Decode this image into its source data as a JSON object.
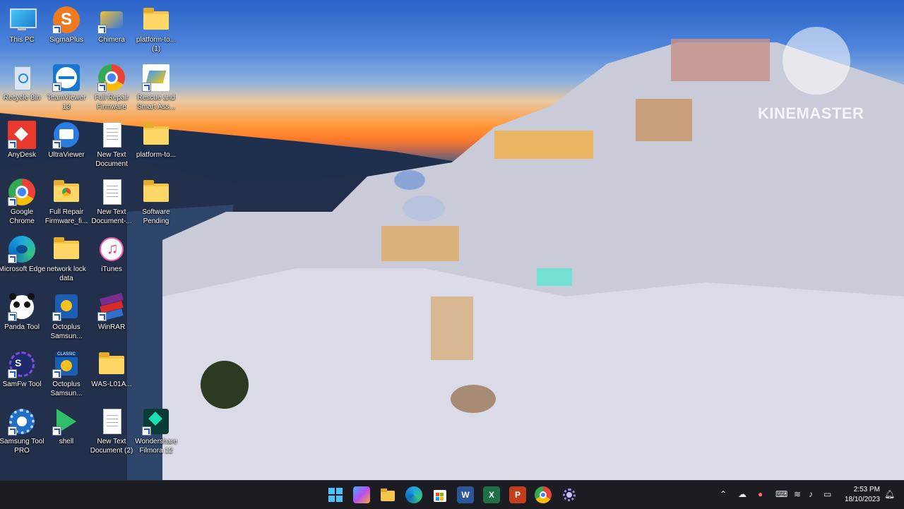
{
  "desktop": {
    "icons": [
      {
        "label": "This PC",
        "icon": "monitor-icon"
      },
      {
        "label": "SigmaPlus",
        "icon": "sigmaplus-icon"
      },
      {
        "label": "Chimera",
        "icon": "chimera-icon"
      },
      {
        "label": "platform-to... (1)",
        "icon": "folder-icon"
      },
      {
        "label": "Recycle Bin",
        "icon": "recycle-bin-icon"
      },
      {
        "label": "TeamViewer 13",
        "icon": "teamviewer-icon"
      },
      {
        "label": "Full Repair Firmware",
        "icon": "chrome-icon"
      },
      {
        "label": "Rescue and Smart Ass...",
        "icon": "rescue-smart-assistant-icon"
      },
      {
        "label": "AnyDesk",
        "icon": "anydesk-icon"
      },
      {
        "label": "UltraViewer",
        "icon": "ultraviewer-icon"
      },
      {
        "label": "New Text Document",
        "icon": "text-document-icon"
      },
      {
        "label": "platform-to...",
        "icon": "folder-icon"
      },
      {
        "label": "Google Chrome",
        "icon": "chrome-icon"
      },
      {
        "label": "Full Repair Firmware_fi...",
        "icon": "folder-icon"
      },
      {
        "label": "New Text Document-...",
        "icon": "text-document-icon"
      },
      {
        "label": "Software Pending",
        "icon": "folder-icon"
      },
      {
        "label": "Microsoft Edge",
        "icon": "edge-icon"
      },
      {
        "label": "network lock data",
        "icon": "folder-icon"
      },
      {
        "label": "iTunes",
        "icon": "itunes-icon"
      },
      {
        "label": "Panda Tool",
        "icon": "panda-icon"
      },
      {
        "label": "Octoplus Samsun...",
        "icon": "octoplus-icon"
      },
      {
        "label": "WinRAR",
        "icon": "winrar-icon"
      },
      {
        "label": "SamFw Tool",
        "icon": "samfw-icon"
      },
      {
        "label": "Octoplus Samsun...",
        "icon": "octoplus-classic-icon"
      },
      {
        "label": "WAS-L01A...",
        "icon": "folder-icon"
      },
      {
        "label": "Samsung Tool PRO",
        "icon": "samsung-tool-icon"
      },
      {
        "label": "shell",
        "icon": "shell-icon"
      },
      {
        "label": "New Text Document (2)",
        "icon": "text-document-icon"
      },
      {
        "label": "Wondershare Filmora 12",
        "icon": "filmora-icon"
      }
    ]
  },
  "watermark": {
    "text": "KINEMASTER",
    "icon": "kinemaster-logo"
  },
  "taskbar": {
    "apps": [
      {
        "name": "start-icon"
      },
      {
        "name": "copilot-icon"
      },
      {
        "name": "file-explorer-icon"
      },
      {
        "name": "edge-icon"
      },
      {
        "name": "microsoft-store-icon"
      },
      {
        "name": "word-icon"
      },
      {
        "name": "excel-icon"
      },
      {
        "name": "powerpoint-icon"
      },
      {
        "name": "chrome-icon"
      },
      {
        "name": "settings-gear-icon"
      }
    ],
    "tray": {
      "time": "2:53 PM",
      "date": "18/10/2023"
    }
  }
}
